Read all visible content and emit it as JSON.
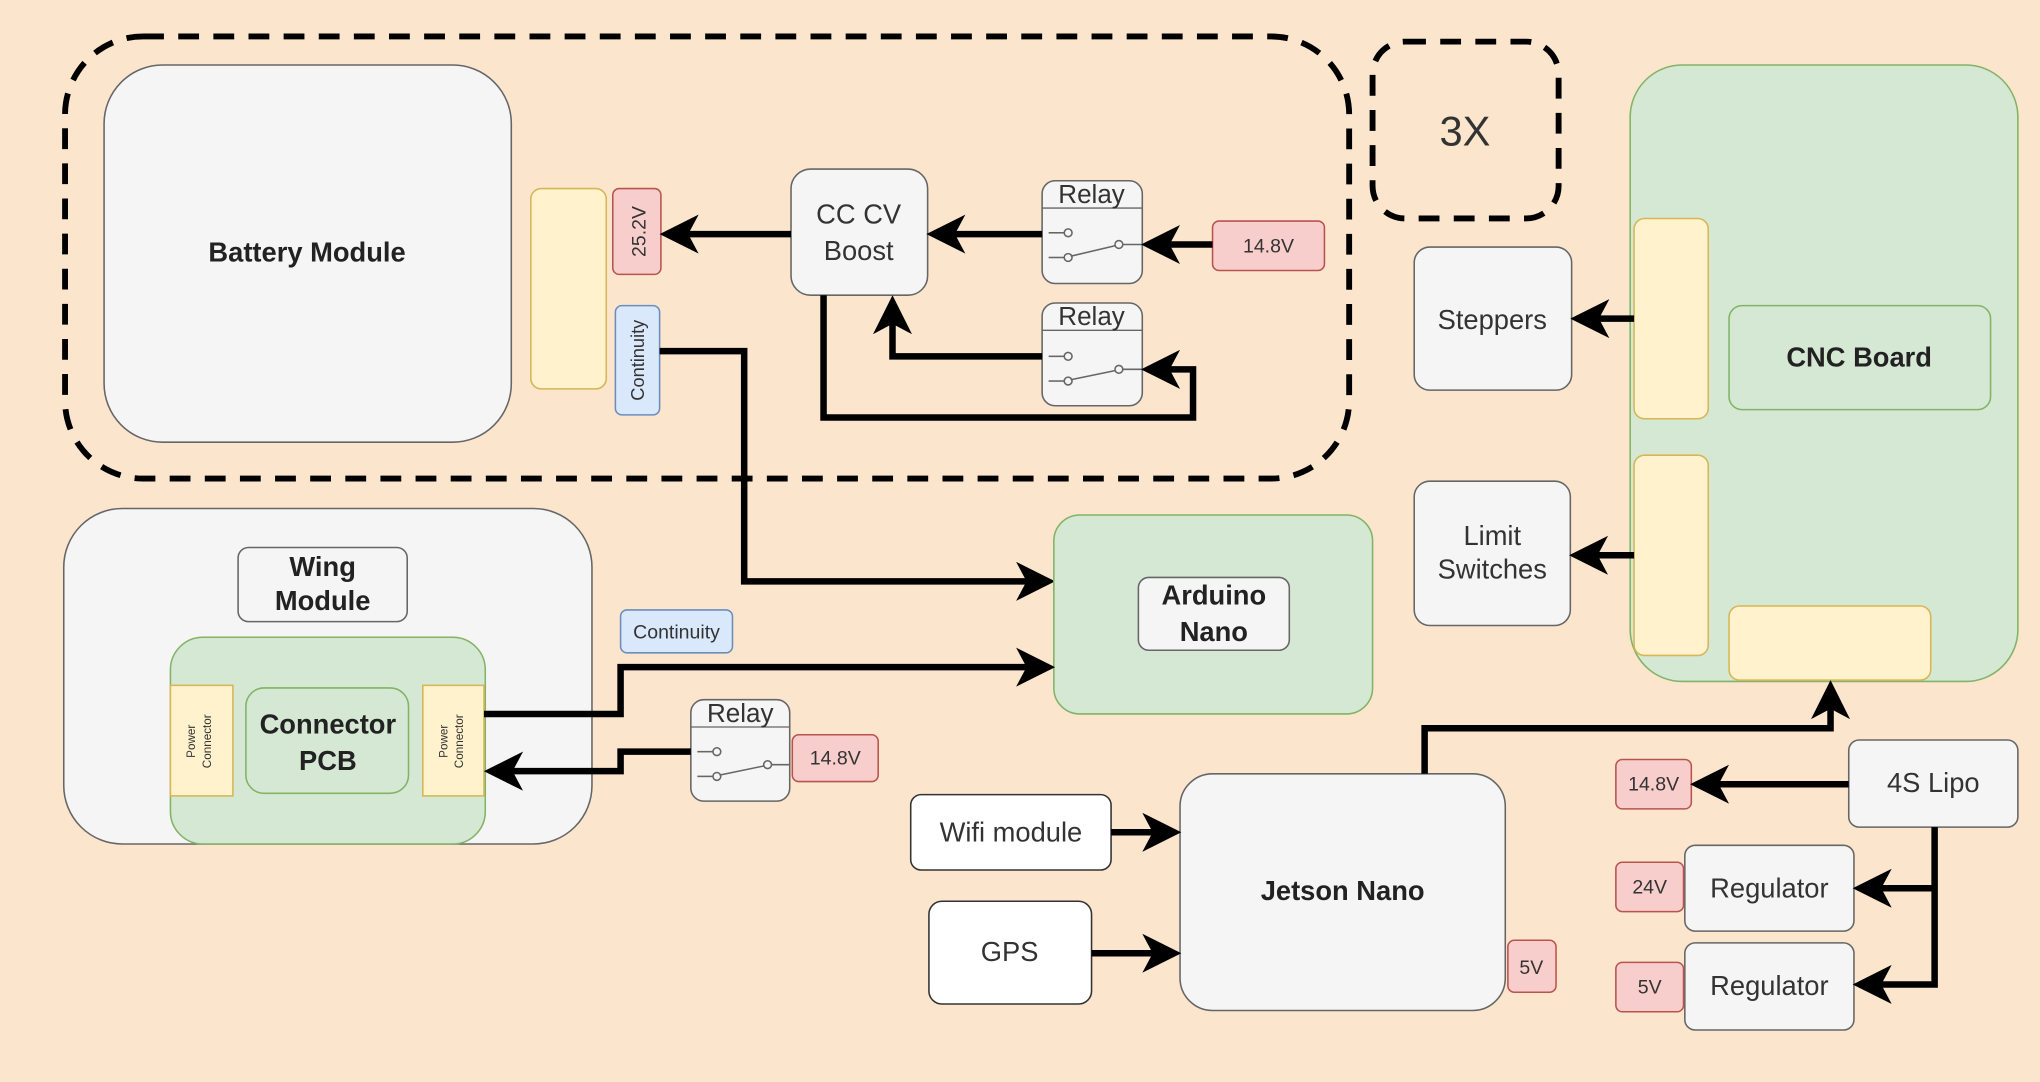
{
  "colors": {
    "background": "#fbe5cd",
    "neutral_fill": "#f5f5f5",
    "green_fill": "#d5e8d4",
    "yellow_fill": "#fff2cc",
    "red_tag": "#f8cecc",
    "blue_tag": "#dae8fc"
  },
  "battery_group": {
    "battery_module": "Battery Module",
    "voltage_tag": "25.2V",
    "continuity_tag": "Continuity",
    "boost": [
      "CC CV",
      "Boost"
    ],
    "relay_top": "Relay",
    "relay_bottom": "Relay",
    "input_tag": "14.8V"
  },
  "multiplier": "3X",
  "wing": {
    "title": [
      "Wing",
      "Module"
    ],
    "connector_pcb": [
      "Connector",
      "PCB"
    ],
    "power_connector_left": [
      "Power",
      "Connector"
    ],
    "power_connector_right": [
      "Power",
      "Connector"
    ],
    "continuity_tag": "Continuity",
    "relay": "Relay",
    "relay_tag": "14.8V"
  },
  "arduino": [
    "Arduino",
    "Nano"
  ],
  "cnc": {
    "title": "CNC Board",
    "steppers": "Steppers",
    "limit_switches": [
      "Limit",
      "Switches"
    ]
  },
  "jetson": {
    "title": "Jetson Nano",
    "voltage_tag": "5V",
    "wifi": "Wifi module",
    "gps": "GPS"
  },
  "power": {
    "lipo": "4S Lipo",
    "lipo_tag": "14.8V",
    "regulator_1": "Regulator",
    "regulator_1_tag": "24V",
    "regulator_2": "Regulator",
    "regulator_2_tag": "5V"
  }
}
